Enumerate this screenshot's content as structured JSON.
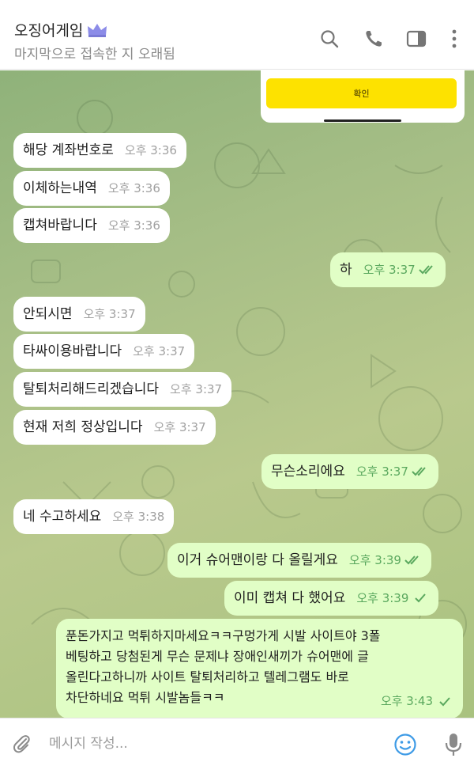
{
  "header": {
    "title": "오징어게임",
    "status": "마지막으로 접속한 지 오래됨",
    "icons": [
      "crown-icon",
      "search-icon",
      "phone-icon",
      "sidebar-icon",
      "more-icon"
    ],
    "accent": "#6f6fd8"
  },
  "card": {
    "confirm_label": "확인",
    "button_color": "#fde200"
  },
  "messages": [
    {
      "text": "해당 계좌번호로",
      "time": "오후 3:36",
      "dir": "in"
    },
    {
      "text": "이체하는내역",
      "time": "오후 3:36",
      "dir": "in"
    },
    {
      "text": "캡쳐바랍니다",
      "time": "오후 3:36",
      "dir": "in"
    },
    {
      "text": "하",
      "time": "오후 3:37",
      "dir": "out",
      "status": "read"
    },
    {
      "text": "안되시면",
      "time": "오후 3:37",
      "dir": "in"
    },
    {
      "text": "타싸이용바랍니다",
      "time": "오후 3:37",
      "dir": "in"
    },
    {
      "text": "탈퇴처리해드리겠습니다",
      "time": "오후 3:37",
      "dir": "in"
    },
    {
      "text": "현재 저희 정상입니다",
      "time": "오후 3:37",
      "dir": "in"
    },
    {
      "text": "무슨소리에요",
      "time": "오후 3:37",
      "dir": "out",
      "status": "read"
    },
    {
      "text": "네 수고하세요",
      "time": "오후 3:38",
      "dir": "in"
    },
    {
      "text": "이거 슈어맨이랑 다 올릴게요",
      "time": "오후 3:39",
      "dir": "out",
      "status": "read"
    },
    {
      "text": "이미 캡쳐 다 했어요",
      "time": "오후 3:39",
      "dir": "out",
      "status": "sent"
    },
    {
      "lines": [
        "푼돈가지고 먹튀하지마세요ㅋㅋ구멍가게 시발 사이트야 3폴",
        "베팅하고 당첨된게 무슨 문제냐 장애인새끼가 슈어맨에 글",
        "올린다고하니까 사이트 탈퇴처리하고 텔레그램도 바로",
        "차단하네요 먹튀 시발놈들ㅋㅋ"
      ],
      "time": "오후 3:43",
      "dir": "out",
      "status": "sent"
    }
  ],
  "input": {
    "placeholder": "메시지 작성..."
  },
  "colors": {
    "incoming": "#ffffff",
    "outgoing": "#e1fec6",
    "check": "#5aa85e",
    "emoji": "#3e9be6"
  }
}
